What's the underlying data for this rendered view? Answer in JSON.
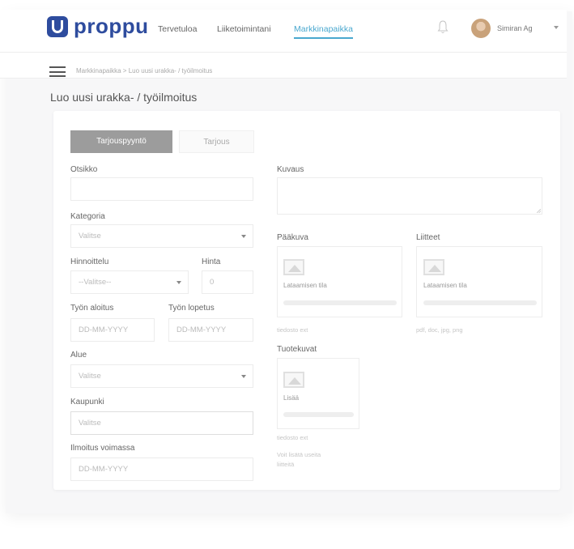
{
  "header": {
    "logo_text": "proppu",
    "nav": [
      "Tervetuloa",
      "Liiketoimintani",
      "Markkinapaikka"
    ],
    "user_name": "Simiran Ag"
  },
  "breadcrumb": "Markkinapaikka > Luo uusi urakka- / työilmoitus",
  "page_title": "Luo uusi urakka- / työilmoitus",
  "tabs": [
    "Tarjouspyyntö",
    "Tarjous"
  ],
  "form": {
    "otsikko_label": "Otsikko",
    "kategoria_label": "Kategoria",
    "kategoria_value": "Valitse",
    "hinnoittelu_label": "Hinnoittelu",
    "hinnoittelu_value": "--Valitse--",
    "hinta_label": "Hinta",
    "hinta_value": "0",
    "aloitus_label": "Työn aloitus",
    "aloitus_placeholder": "DD-MM-YYYY",
    "lopetus_label": "Työn lopetus",
    "lopetus_placeholder": "DD-MM-YYYY",
    "alue_label": "Alue",
    "alue_value": "Valitse",
    "kaupunki_label": "Kaupunki",
    "kaupunki_placeholder": "Valitse",
    "voimassa_label": "Ilmoitus voimassa",
    "voimassa_placeholder": "DD-MM-YYYY",
    "kuvaus_label": "Kuvaus"
  },
  "uploads": {
    "paakuva_label": "Pääkuva",
    "paakuva_status": "Lataamisen tila",
    "paakuva_hint": "tiedosto ext",
    "liitteet_label": "Liitteet",
    "liitteet_status": "Lataamisen tila",
    "liitteet_hint": "pdf, doc, jpg, png",
    "tuotekuvat_label": "Tuotekuvat",
    "tuotekuvat_status": "Lisää",
    "tuotekuvat_hint": "tiedosto ext",
    "tuotekuvat_note_1": "Voit lisätä useita",
    "tuotekuvat_note_2": "liitteitä"
  },
  "colors": {
    "brand": "#2e4c9e",
    "accent": "#4aa8cf",
    "active_tab": "#9c9c9c"
  }
}
